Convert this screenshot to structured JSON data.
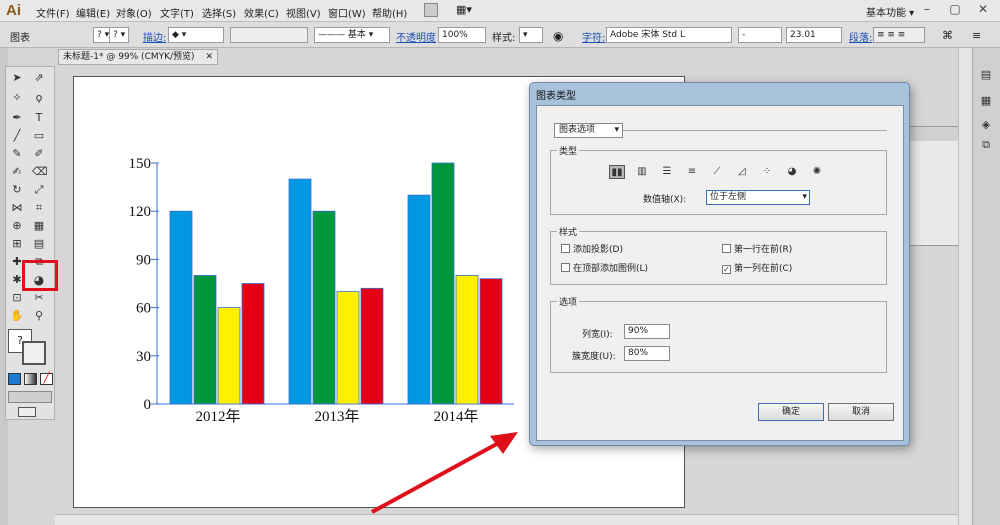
{
  "app": {
    "logo": "Ai"
  },
  "menu": [
    "文件(F)",
    "编辑(E)",
    "对象(O)",
    "文字(T)",
    "选择(S)",
    "效果(C)",
    "视图(V)",
    "窗口(W)",
    "帮助(H)"
  ],
  "workspace": {
    "label": "基本功能"
  },
  "control_bar": {
    "object_label": "图表",
    "stroke_label": "描边:",
    "brush_value": "基本",
    "opacity_label": "不透明度",
    "opacity_value": "100%",
    "style_label": "样式:",
    "char_label": "字符:",
    "font_value": "Adobe 宋体 Std L",
    "font_style_value": "-",
    "font_size_value": "23.01",
    "para_label": "段落:"
  },
  "document_tab": {
    "label": "未标题-1* @ 99% (CMYK/预览)"
  },
  "chart_data": {
    "type": "bar",
    "categories": [
      "2012年",
      "2013年",
      "2014年"
    ],
    "series": [
      {
        "color": "#0098e0",
        "values": [
          120,
          140,
          130
        ]
      },
      {
        "color": "#00963c",
        "values": [
          80,
          120,
          150
        ]
      },
      {
        "color": "#fff000",
        "values": [
          60,
          70,
          80
        ]
      },
      {
        "color": "#e30014",
        "values": [
          75,
          72,
          78
        ]
      }
    ],
    "yticks": [
      "150",
      "120",
      "90",
      "60",
      "30",
      "0"
    ],
    "ylim": [
      0,
      150
    ]
  },
  "dialog": {
    "title": "图表类型",
    "options_dropdown": "图表选项",
    "type_group": "类型",
    "value_axis_label": "数值轴(X):",
    "value_axis_value": "位于左侧",
    "style_group": "样式",
    "checkboxes": [
      {
        "label": "添加投影(D)",
        "checked": false
      },
      {
        "label": "在顶部添加图例(L)",
        "checked": false
      },
      {
        "label": "第一行在前(R)",
        "checked": false
      },
      {
        "label": "第一列在前(C)",
        "checked": true
      }
    ],
    "options_group": "选项",
    "column_width_label": "列宽(I):",
    "column_width_value": "90%",
    "cluster_width_label": "簇宽度(U):",
    "cluster_width_value": "80%",
    "ok_label": "确定",
    "cancel_label": "取消"
  }
}
